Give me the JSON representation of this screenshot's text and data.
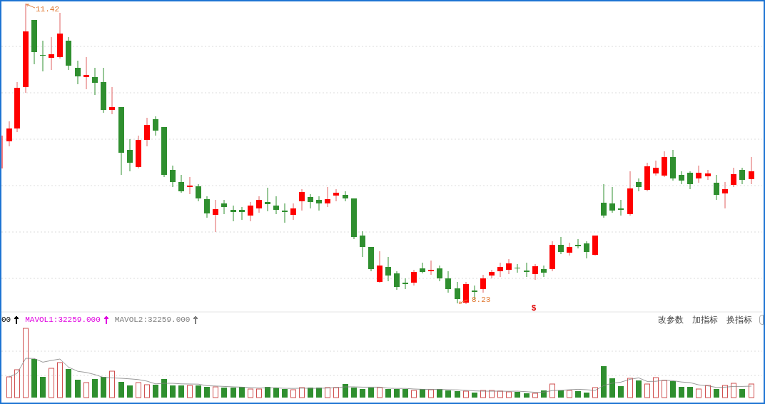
{
  "chart": {
    "high_label": "11.42",
    "low_label": "8.23",
    "signal_marker": "$"
  },
  "volume_legend": [
    {
      "text": "00",
      "color": "#000000"
    },
    {
      "text": "MAVOL1:32259.000",
      "color": "#e000e0"
    },
    {
      "text": "MAVOL2:32259.000",
      "color": "#808080"
    }
  ],
  "buttons": [
    "改参数",
    "加指标",
    "换指标"
  ]
}
